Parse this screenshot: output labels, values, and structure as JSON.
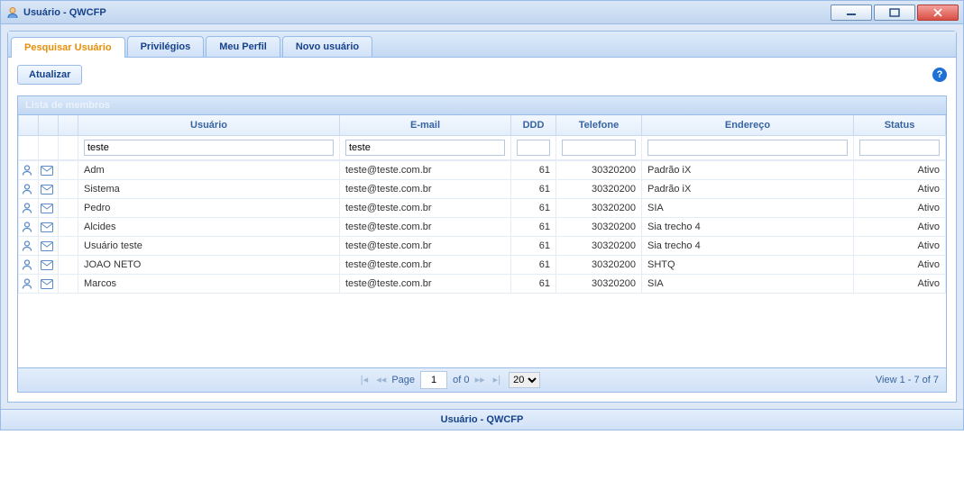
{
  "window": {
    "title": "Usuário - QWCFP"
  },
  "tabs": [
    {
      "label": "Pesquisar Usuário",
      "active": true
    },
    {
      "label": "Privilégios",
      "active": false
    },
    {
      "label": "Meu Perfil",
      "active": false
    },
    {
      "label": "Novo usuário",
      "active": false
    }
  ],
  "toolbar": {
    "update_label": "Atualizar"
  },
  "grid": {
    "title": "Lista de membros",
    "columns": {
      "user": "Usuário",
      "email": "E-mail",
      "ddd": "DDD",
      "phone": "Telefone",
      "address": "Endereço",
      "status": "Status"
    },
    "filters": {
      "user": "teste",
      "email": "teste",
      "ddd": "",
      "phone": "",
      "address": "",
      "status": ""
    },
    "rows": [
      {
        "user": "Adm",
        "email": "teste@teste.com.br",
        "ddd": "61",
        "phone": "30320200",
        "address": "Padrão iX",
        "status": "Ativo"
      },
      {
        "user": "Sistema",
        "email": "teste@teste.com.br",
        "ddd": "61",
        "phone": "30320200",
        "address": "Padrão iX",
        "status": "Ativo"
      },
      {
        "user": "Pedro",
        "email": "teste@teste.com.br",
        "ddd": "61",
        "phone": "30320200",
        "address": "SIA",
        "status": "Ativo"
      },
      {
        "user": "Alcides",
        "email": "teste@teste.com.br",
        "ddd": "61",
        "phone": "30320200",
        "address": "Sia trecho 4",
        "status": "Ativo"
      },
      {
        "user": "Usuário teste",
        "email": "teste@teste.com.br",
        "ddd": "61",
        "phone": "30320200",
        "address": "Sia trecho 4",
        "status": "Ativo"
      },
      {
        "user": "JOAO NETO",
        "email": "teste@teste.com.br",
        "ddd": "61",
        "phone": "30320200",
        "address": "SHTQ",
        "status": "Ativo"
      },
      {
        "user": "Marcos",
        "email": "teste@teste.com.br",
        "ddd": "61",
        "phone": "30320200",
        "address": "SIA",
        "status": "Ativo"
      }
    ]
  },
  "paging": {
    "page_label": "Page",
    "page_value": "1",
    "of_label": "of 0",
    "pagesize": "20",
    "view_label": "View 1 - 7 of 7"
  },
  "footer": {
    "text": "Usuário - QWCFP"
  }
}
